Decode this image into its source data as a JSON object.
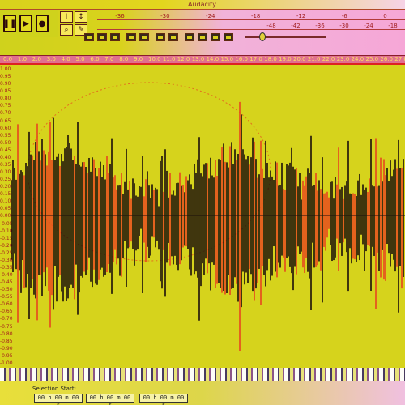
{
  "window": {
    "title": "Audacity"
  },
  "meters": {
    "ticks": [
      "-36",
      "-30",
      "-24",
      "-18",
      "-12",
      "-6",
      "0",
      "-48",
      "-42",
      "-36",
      "-30",
      "-24",
      "-18"
    ]
  },
  "ruler": {
    "labels": [
      "0.0",
      "1.0",
      "2.0",
      "3.0",
      "4.0",
      "5.0",
      "6.0",
      "7.0",
      "8.0",
      "9.0",
      "10.0",
      "11.0",
      "12.0",
      "13.0",
      "14.0",
      "15.0",
      "16.0",
      "17.0",
      "18.0",
      "19.0",
      "20.0",
      "21.0",
      "22.0",
      "23.0",
      "24.0",
      "25.0",
      "26.0",
      "27.0"
    ]
  },
  "track": {
    "scale_labels": [
      "1.00",
      "0.95",
      "0.90",
      "0.85",
      "0.80",
      "0.75",
      "0.70",
      "0.65",
      "0.60",
      "0.55",
      "0.50",
      "0.45",
      "0.40",
      "0.35",
      "0.30",
      "0.25",
      "0.20",
      "0.15",
      "0.10",
      "0.05",
      "0.00",
      "-0.05",
      "-0.10",
      "-0.15",
      "-0.20",
      "-0.25",
      "-0.30",
      "-0.35",
      "-0.40",
      "-0.45",
      "-0.50",
      "-0.55",
      "-0.60",
      "-0.65",
      "-0.70",
      "-0.75",
      "-0.80",
      "-0.85",
      "-0.90",
      "-0.95",
      "-1.00"
    ]
  },
  "selection": {
    "label": "Selection Start:",
    "start": "00 h 00 m 00 s",
    "end": "00 h 00 m 00 s",
    "audio_position": "00 h 00 m 00 s"
  },
  "colors": {
    "waveform": "#1a0f0a",
    "waveform_accent": "#e8461e",
    "background": "#d6d31c"
  }
}
